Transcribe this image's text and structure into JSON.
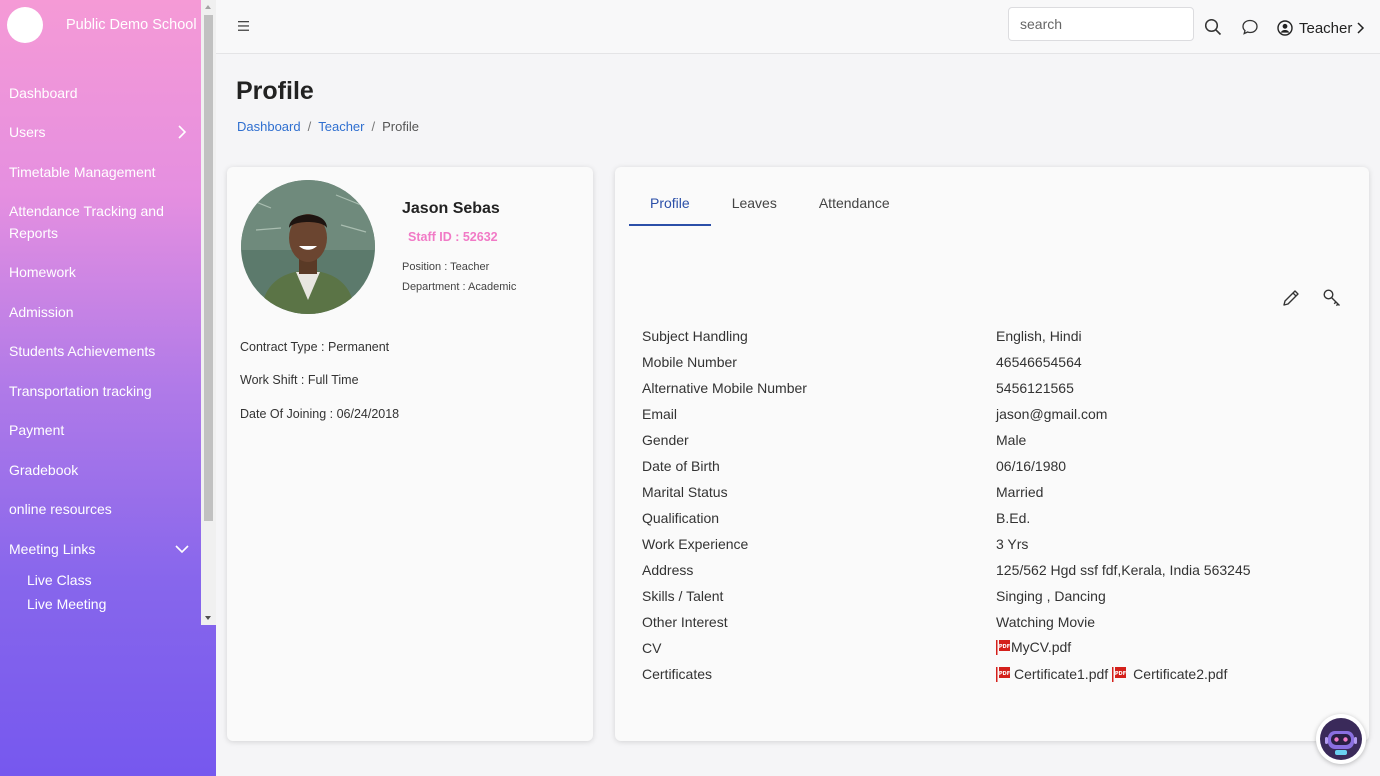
{
  "brand": {
    "name": "Public Demo School"
  },
  "sidebar": {
    "items": [
      {
        "label": "Dashboard"
      },
      {
        "label": "Users"
      },
      {
        "label": "Timetable Management"
      },
      {
        "label": "Attendance Tracking and Reports"
      },
      {
        "label": "Homework"
      },
      {
        "label": "Admission"
      },
      {
        "label": "Students Achievements"
      },
      {
        "label": "Transportation tracking"
      },
      {
        "label": "Payment"
      },
      {
        "label": "Gradebook"
      },
      {
        "label": "online resources"
      },
      {
        "label": "Meeting Links"
      }
    ],
    "subitems": [
      {
        "label": "Live Class"
      },
      {
        "label": "Live Meeting"
      }
    ]
  },
  "topbar": {
    "search_placeholder": "search",
    "user_label": "Teacher",
    "icons": [
      "menu-icon",
      "search-icon",
      "chat-icon",
      "user-circle-icon",
      "chevron-right-icon"
    ]
  },
  "page": {
    "title": "Profile",
    "breadcrumb": [
      {
        "label": "Dashboard"
      },
      {
        "label": "Teacher"
      },
      {
        "label": "Profile"
      }
    ]
  },
  "profile_card": {
    "name": "Jason Sebas",
    "staff_id": "Staff ID : 52632",
    "position": "Position : Teacher",
    "department": "Department : Academic",
    "contract_type": "Contract Type : Permanent",
    "work_shift": "Work Shift : Full Time",
    "date_of_joining": "Date Of Joining : 06/24/2018"
  },
  "details": {
    "tabs": [
      {
        "label": "Profile",
        "active": true
      },
      {
        "label": "Leaves",
        "active": false
      },
      {
        "label": "Attendance",
        "active": false
      }
    ],
    "rows": [
      {
        "label": "Subject Handling",
        "value": "English, Hindi"
      },
      {
        "label": "Mobile Number",
        "value": "46546654564"
      },
      {
        "label": "Alternative Mobile Number",
        "value": "5456121565"
      },
      {
        "label": "Email",
        "value": "jason@gmail.com"
      },
      {
        "label": "Gender",
        "value": "Male"
      },
      {
        "label": "Date of Birth",
        "value": "06/16/1980"
      },
      {
        "label": "Marital Status",
        "value": "Married"
      },
      {
        "label": "Qualification",
        "value": "B.Ed."
      },
      {
        "label": "Work Experience",
        "value": "3 Yrs"
      },
      {
        "label": "Address",
        "value": "125/562 Hgd ssf fdf,Kerala, India 563245"
      },
      {
        "label": "Skills / Talent",
        "value": "Singing , Dancing"
      },
      {
        "label": "Other Interest",
        "value": "Watching Movie"
      }
    ],
    "cv": {
      "label": "CV",
      "files": [
        "MyCV.pdf"
      ]
    },
    "certificates": {
      "label": "Certificates",
      "files": [
        "Certificate1.pdf",
        "Certificate2.pdf"
      ]
    }
  },
  "colors": {
    "accent_pink": "#f17ac6",
    "tab_active": "#2b4fa8",
    "link_blue": "#2f6fd0",
    "pdf_red": "#d4201b"
  }
}
